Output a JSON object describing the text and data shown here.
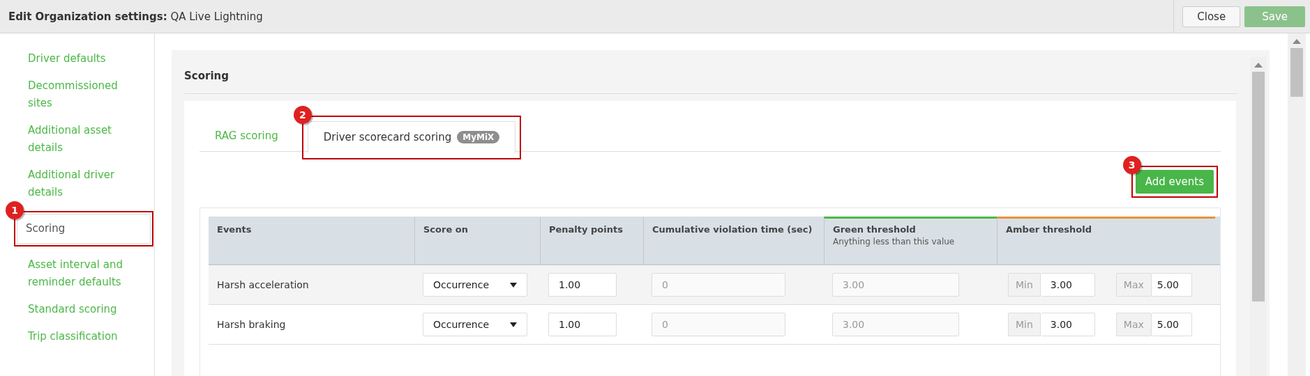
{
  "header": {
    "title_label": "Edit Organization settings:",
    "title_value": "QA Live Lightning",
    "buttons": [
      {
        "label": "Close",
        "kind": "secondary",
        "disabled": false
      },
      {
        "label": "Save",
        "kind": "primary",
        "disabled": true
      }
    ]
  },
  "sidebar": {
    "items": [
      {
        "label": "Driver defaults",
        "selected": false
      },
      {
        "label": "Decommissioned sites",
        "selected": false
      },
      {
        "label": "Additional asset details",
        "selected": false
      },
      {
        "label": "Additional driver details",
        "selected": false
      },
      {
        "label": "Scoring",
        "selected": true,
        "callout": "1"
      },
      {
        "label": "Asset interval and reminder defaults",
        "selected": false
      },
      {
        "label": "Standard scoring",
        "selected": false
      },
      {
        "label": "Trip classification",
        "selected": false
      }
    ]
  },
  "section": {
    "title": "Scoring",
    "tabs": [
      {
        "label": "RAG scoring",
        "selected": false
      },
      {
        "label": "Driver scorecard scoring",
        "badge": "MyMiX",
        "selected": true,
        "callout": "2"
      }
    ],
    "add_button": {
      "label": "Add events",
      "callout": "3"
    },
    "table": {
      "columns": [
        {
          "label": "Events"
        },
        {
          "label": "Score on"
        },
        {
          "label": "Penalty points"
        },
        {
          "label": "Cumulative violation time (sec)"
        },
        {
          "label": "Green threshold",
          "subtitle": "Anything less than this value",
          "color": "#4cb847"
        },
        {
          "label": "Amber threshold",
          "color": "#e8913a"
        }
      ],
      "rows": [
        {
          "event": "Harsh acceleration",
          "score_on": "Occurrence",
          "penalty_points": "1.00",
          "violation_time": "0",
          "green_threshold": "3.00",
          "amber_min_label": "Min",
          "amber_min": "3.00",
          "amber_max_label": "Max",
          "amber_max": "5.00"
        },
        {
          "event": "Harsh braking",
          "score_on": "Occurrence",
          "penalty_points": "1.00",
          "violation_time": "0",
          "green_threshold": "3.00",
          "amber_min_label": "Min",
          "amber_min": "3.00",
          "amber_max_label": "Max",
          "amber_max": "5.00"
        }
      ]
    }
  }
}
